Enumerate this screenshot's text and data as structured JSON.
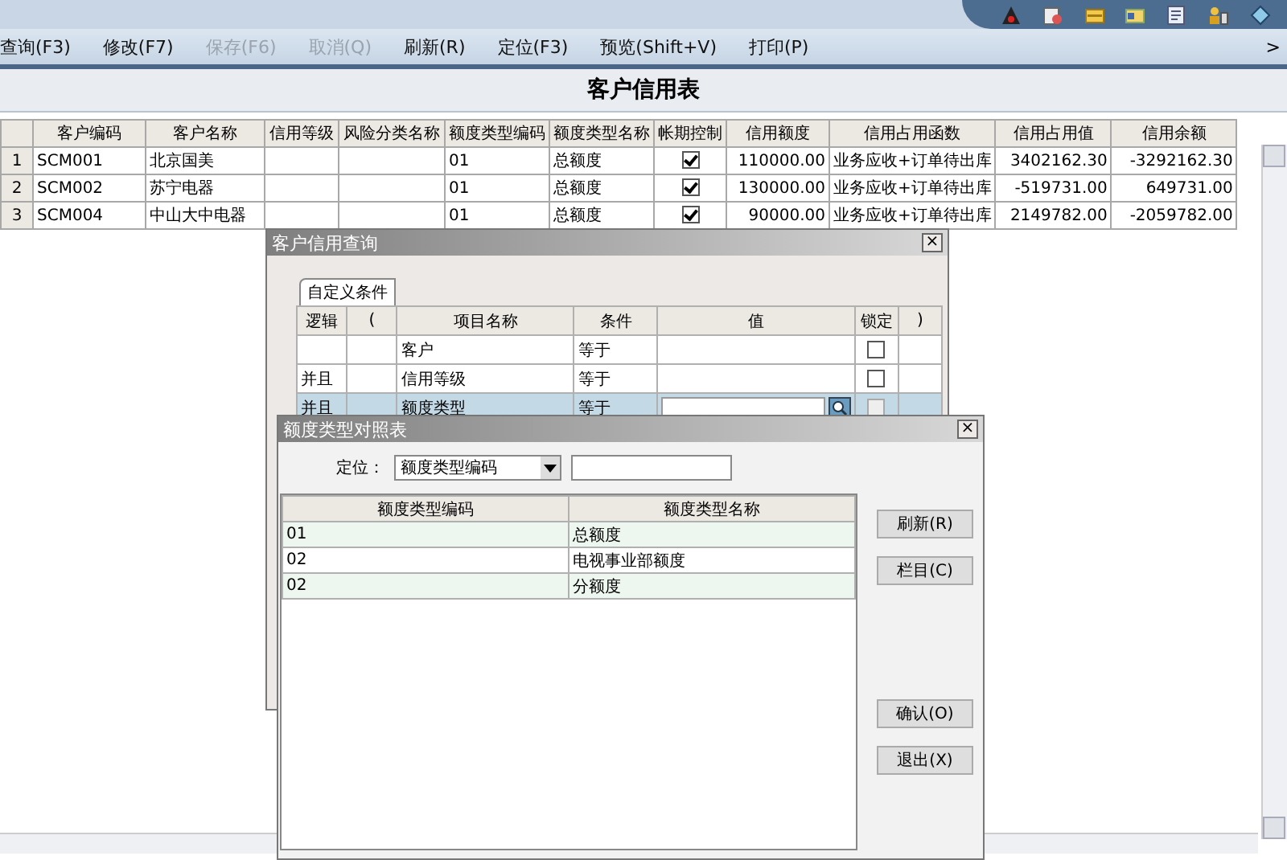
{
  "toolbar": {
    "items": [
      {
        "label": "查询(F3)",
        "disabled": false
      },
      {
        "label": "修改(F7)",
        "disabled": false
      },
      {
        "label": "保存(F6)",
        "disabled": true
      },
      {
        "label": "取消(Q)",
        "disabled": true
      },
      {
        "label": "刷新(R)",
        "disabled": false
      },
      {
        "label": "定位(F3)",
        "disabled": false
      },
      {
        "label": "预览(Shift+V)",
        "disabled": false
      },
      {
        "label": "打印(P)",
        "disabled": false
      }
    ],
    "overflow": ">"
  },
  "title": "客户信用表",
  "table": {
    "columns": [
      "客户编码",
      "客户名称",
      "信用等级",
      "风险分类名称",
      "额度类型编码",
      "额度类型名称",
      "帐期控制",
      "信用额度",
      "信用占用函数",
      "信用占用值",
      "信用余额"
    ],
    "rows": [
      {
        "number": "1",
        "cells": [
          "SCM001",
          "北京国美",
          null,
          null,
          "01",
          "总额度",
          true,
          "110000.00",
          "业务应收+订单待出库",
          "3402162.30",
          "-3292162.30"
        ]
      },
      {
        "number": "2",
        "cells": [
          "SCM002",
          "苏宁电器",
          null,
          null,
          "01",
          "总额度",
          true,
          "130000.00",
          "业务应收+订单待出库",
          "-519731.00",
          "649731.00"
        ]
      },
      {
        "number": "3",
        "cells": [
          "SCM004",
          "中山大中电器",
          null,
          null,
          "01",
          "总额度",
          true,
          "90000.00",
          "业务应收+订单待出库",
          "2149782.00",
          "-2059782.00"
        ]
      }
    ]
  },
  "query_dialog": {
    "title": "客户信用查询",
    "close": "×",
    "tabs": [
      {
        "label": "自定义条件",
        "selected": true
      }
    ],
    "columns": [
      "逻辑",
      "(",
      "项目名称",
      "条件",
      "值",
      "锁定",
      ")"
    ],
    "rows": [
      {
        "logic": null,
        "item": "客户",
        "condition": "等于",
        "kind": "plain",
        "locked": false,
        "selected": false
      },
      {
        "logic": "并且",
        "item": "信用等级",
        "condition": "等于",
        "kind": "plain",
        "locked": false,
        "selected": false
      },
      {
        "logic": "并且",
        "item": "额度类型",
        "condition": "等于",
        "kind": "lookup",
        "locked": false,
        "selected": true
      }
    ]
  },
  "lookup_dialog": {
    "title": "额度类型对照表",
    "close": "×",
    "locate_label": "定位：",
    "locate_field": "额度类型编码",
    "columns": [
      "额度类型编码",
      "额度类型名称"
    ],
    "rows": [
      [
        "01",
        "总额度"
      ],
      [
        "02",
        "电视事业部额度"
      ],
      [
        "02",
        "分额度"
      ]
    ],
    "buttons": [
      "刷新(R)",
      "栏目(C)",
      "确认(O)",
      "退出(X)"
    ]
  }
}
